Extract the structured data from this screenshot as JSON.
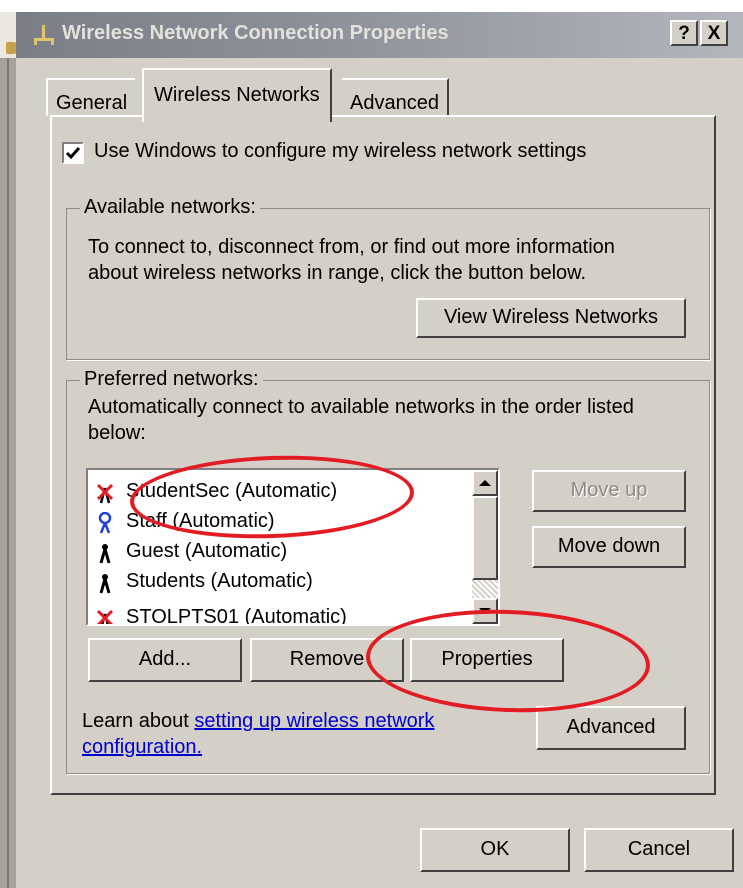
{
  "window": {
    "title": "Wireless Network Connection Properties",
    "help_button": "?",
    "close_button": "X"
  },
  "tabs": [
    {
      "label": "General",
      "selected": false
    },
    {
      "label": "Wireless Networks",
      "selected": true
    },
    {
      "label": "Advanced",
      "selected": false
    }
  ],
  "use_windows_checkbox": {
    "label": "Use Windows to configure my wireless network settings",
    "checked": true
  },
  "available_networks": {
    "legend": "Available networks:",
    "description_line1": "To connect to, disconnect from, or find out more information",
    "description_line2": "about wireless networks in range, click the button below.",
    "view_button": "View Wireless Networks"
  },
  "preferred_networks": {
    "legend": "Preferred networks:",
    "description_line1": "Automatically connect to available networks in the order listed",
    "description_line2": "below:",
    "items": [
      {
        "label": "StudentSec (Automatic)",
        "icon": "network-disconnected-icon"
      },
      {
        "label": "Staff (Automatic)",
        "icon": "network-connected-icon"
      },
      {
        "label": "Guest (Automatic)",
        "icon": "network-antenna-icon"
      },
      {
        "label": "Students (Automatic)",
        "icon": "network-antenna-icon"
      },
      {
        "label": "STOLPTS01 (Automatic)",
        "icon": "network-disconnected-icon"
      }
    ],
    "move_up_button": "Move up",
    "move_up_enabled": false,
    "move_down_button": "Move down",
    "add_button": "Add...",
    "remove_button": "Remove",
    "properties_button": "Properties",
    "learn_text": "Learn about ",
    "learn_link_line1": "setting up wireless network",
    "learn_link_line2": "configuration.",
    "advanced_button": "Advanced"
  },
  "footer": {
    "ok_button": "OK",
    "cancel_button": "Cancel"
  },
  "colors": {
    "dialog_face": "#d4d0c8",
    "annotation_red": "#e31b23",
    "link_blue": "#0000cc",
    "disabled_text": "#8c8a84"
  }
}
